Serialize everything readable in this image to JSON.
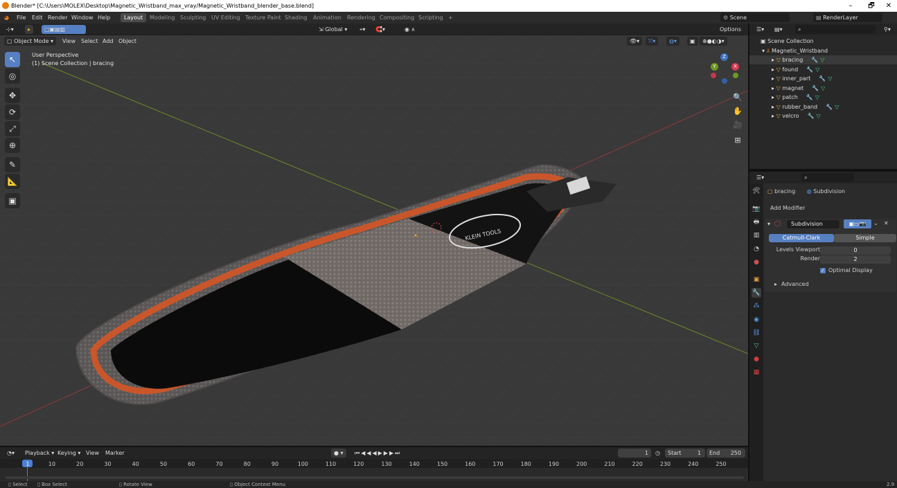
{
  "window": {
    "title": "Blender* [C:\\Users\\MOLEX\\Desktop\\Magnetic_Wristband_max_vray/Magnetic_Wristband_blender_base.blend]",
    "minimize": "–",
    "restore": "🗗",
    "close": "✕"
  },
  "menu": {
    "items": [
      "File",
      "Edit",
      "Render",
      "Window",
      "Help"
    ],
    "workspaces": [
      "Layout",
      "Modeling",
      "Sculpting",
      "UV Editing",
      "Texture Paint",
      "Shading",
      "Animation",
      "Rendering",
      "Compositing",
      "Scripting"
    ],
    "add_tab": "+",
    "scene": "Scene",
    "render_layer": "RenderLayer"
  },
  "viewport": {
    "mode": "Object Mode",
    "menus": [
      "View",
      "Select",
      "Add",
      "Object"
    ],
    "orientation": "Global",
    "options": "Options",
    "perspective_label": "User Perspective",
    "collection_label": "(1) Scene Collection | bracing",
    "logo_text": "KLEIN TOOLS"
  },
  "gizmo": {
    "x": "X",
    "y": "Y",
    "z": "Z"
  },
  "outliner": {
    "root": "Scene Collection",
    "collection": "Magnetic_Wristband",
    "objects": [
      "bracing",
      "found",
      "inner_part",
      "magnet",
      "patch",
      "rubber_band",
      "velcro"
    ]
  },
  "properties": {
    "object_name": "bracing",
    "modifier_breadcrumb": "Subdivision",
    "add_modifier": "Add Modifier",
    "modifier_name": "Subdivision",
    "type_catmull": "Catmull-Clark",
    "type_simple": "Simple",
    "levels_viewport_label": "Levels Viewport",
    "levels_viewport_value": "0",
    "render_label": "Render",
    "render_value": "2",
    "optimal_display": "Optimal Display",
    "advanced": "Advanced"
  },
  "timeline": {
    "menus": [
      "Playback",
      "Keying",
      "View",
      "Marker"
    ],
    "current_frame": "1",
    "start_label": "Start",
    "start_value": "1",
    "end_label": "End",
    "end_value": "250",
    "ticks": [
      "1",
      "10",
      "20",
      "30",
      "40",
      "50",
      "60",
      "70",
      "80",
      "90",
      "100",
      "110",
      "120",
      "130",
      "140",
      "150",
      "160",
      "170",
      "180",
      "190",
      "200",
      "210",
      "220",
      "230",
      "240",
      "250"
    ]
  },
  "status": {
    "select": "Select",
    "box_select": "Box Select",
    "rotate_view": "Rotate View",
    "context_menu": "Object Context Menu",
    "version": "2.9"
  }
}
